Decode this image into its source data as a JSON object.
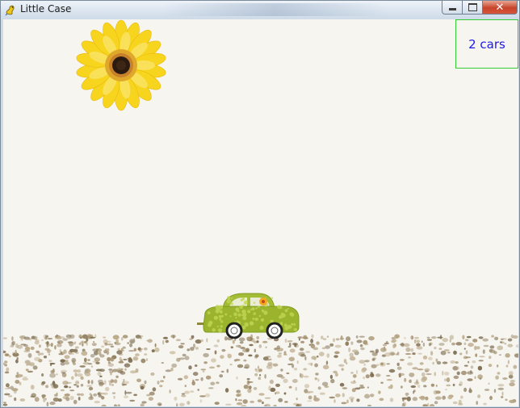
{
  "window": {
    "title": "Little Case",
    "app_icon": "pygame-snake-icon",
    "buttons": {
      "minimize": "minimize-icon",
      "maximize": "maximize-icon",
      "close": "✕"
    }
  },
  "game": {
    "score_text": "2 cars",
    "sprites": [
      "sunflower-sun",
      "green-car",
      "gravel-ground"
    ],
    "colors": {
      "score_text": "#1a1aee",
      "score_border": "#33cc33",
      "background": "#f7f5f0",
      "car_body": "#9ab52d",
      "sun_petals": "#f7d51e"
    }
  }
}
